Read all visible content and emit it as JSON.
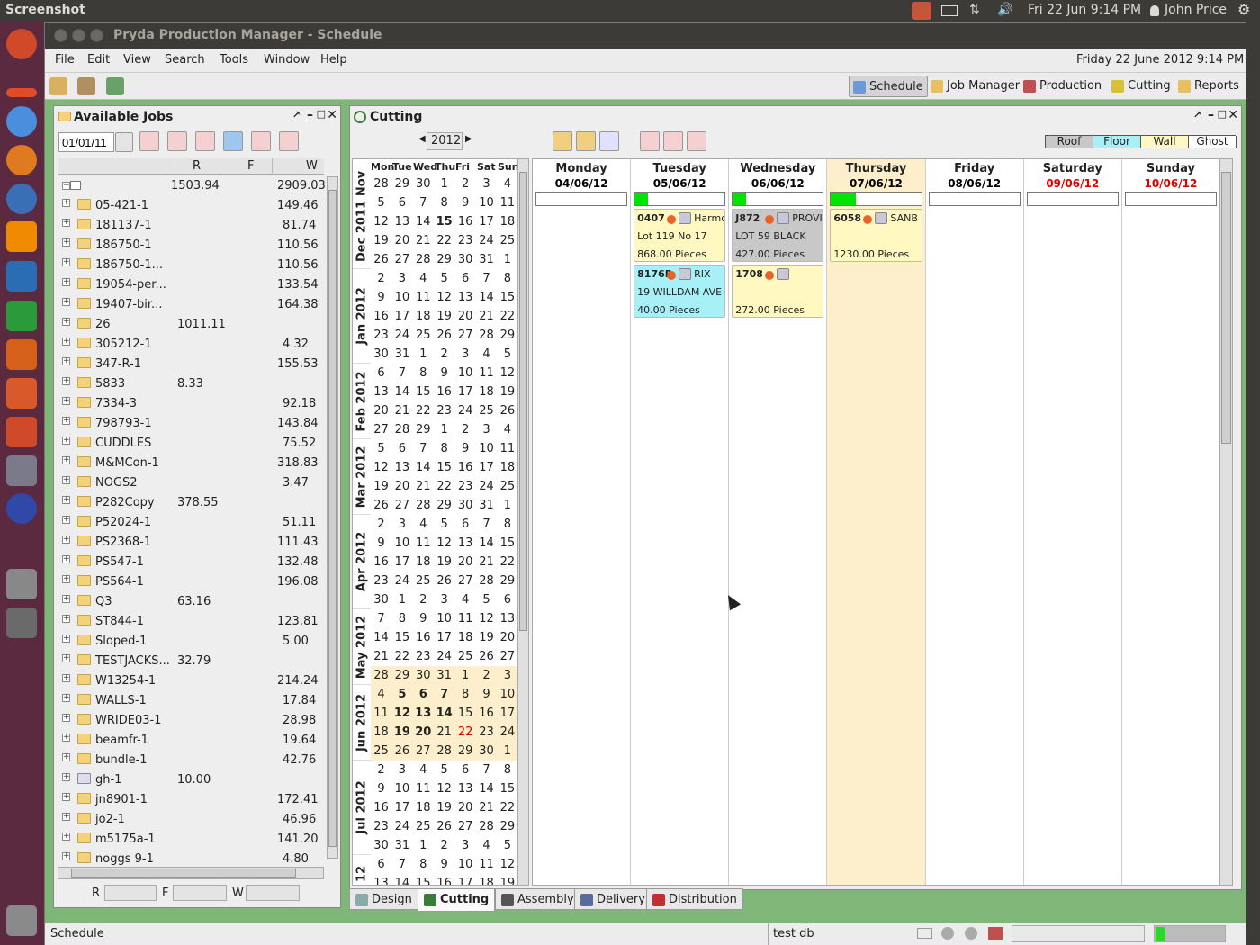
{
  "topbar": {
    "app": "Screenshot",
    "clock": "Fri 22 Jun 9:14 PM",
    "user": "John Price"
  },
  "window": {
    "title": "Pryda Production Manager - Schedule"
  },
  "menu": [
    "File",
    "Edit",
    "View",
    "Search",
    "Tools",
    "Window",
    "Help"
  ],
  "datetime": "Friday 22 June 2012  9:14 PM",
  "nav": [
    {
      "label": "Schedule",
      "active": true
    },
    {
      "label": "Job Manager",
      "active": false
    },
    {
      "label": "Production",
      "active": false
    },
    {
      "label": "Cutting",
      "active": false
    },
    {
      "label": "Reports",
      "active": false
    }
  ],
  "jobs_panel": {
    "title": "Available Jobs",
    "date": "01/01/11",
    "columns": [
      "R",
      "F",
      "W"
    ],
    "root": {
      "r": "1503.94",
      "w": "2909.03"
    },
    "rows": [
      {
        "name": "05-421-1",
        "r": "",
        "w": "149.46"
      },
      {
        "name": "181137-1",
        "r": "",
        "w": "81.74"
      },
      {
        "name": "186750-1",
        "r": "",
        "w": "110.56"
      },
      {
        "name": "186750-1...",
        "r": "",
        "w": "110.56"
      },
      {
        "name": "19054-per...",
        "r": "",
        "w": "133.54"
      },
      {
        "name": "19407-bir...",
        "r": "",
        "w": "164.38"
      },
      {
        "name": "26",
        "r": "1011.11",
        "w": ""
      },
      {
        "name": "305212-1",
        "r": "",
        "w": "4.32"
      },
      {
        "name": "347-R-1",
        "r": "",
        "w": "155.53"
      },
      {
        "name": "5833",
        "r": "8.33",
        "w": ""
      },
      {
        "name": "7334-3",
        "r": "",
        "w": "92.18"
      },
      {
        "name": "798793-1",
        "r": "",
        "w": "143.84"
      },
      {
        "name": "CUDDLES",
        "r": "",
        "w": "75.52"
      },
      {
        "name": "M&MCon-1",
        "r": "",
        "w": "318.83"
      },
      {
        "name": "NOGS2",
        "r": "",
        "w": "3.47"
      },
      {
        "name": "P282Copy",
        "r": "378.55",
        "w": ""
      },
      {
        "name": "P52024-1",
        "r": "",
        "w": "51.11"
      },
      {
        "name": "PS2368-1",
        "r": "",
        "w": "111.43"
      },
      {
        "name": "PS547-1",
        "r": "",
        "w": "132.48"
      },
      {
        "name": "PS564-1",
        "r": "",
        "w": "196.08"
      },
      {
        "name": "Q3",
        "r": "63.16",
        "w": ""
      },
      {
        "name": "ST844-1",
        "r": "",
        "w": "123.81"
      },
      {
        "name": "Sloped-1",
        "r": "",
        "w": "5.00"
      },
      {
        "name": "TESTJACKS...",
        "r": "32.79",
        "w": ""
      },
      {
        "name": "W13254-1",
        "r": "",
        "w": "214.24"
      },
      {
        "name": "WALLS-1",
        "r": "",
        "w": "17.84"
      },
      {
        "name": "WRIDE03-1",
        "r": "",
        "w": "28.98"
      },
      {
        "name": "beamfr-1",
        "r": "",
        "w": "19.64"
      },
      {
        "name": "bundle-1",
        "r": "",
        "w": "42.76"
      },
      {
        "name": "gh-1",
        "r": "10.00",
        "w": ""
      },
      {
        "name": "jn8901-1",
        "r": "",
        "w": "172.41"
      },
      {
        "name": "jo2-1",
        "r": "",
        "w": "46.96"
      },
      {
        "name": "m5175a-1",
        "r": "",
        "w": "141.20"
      },
      {
        "name": "noggs 9-1",
        "r": "",
        "w": "4.80"
      }
    ],
    "footer": [
      "R",
      "F",
      "W"
    ]
  },
  "cutting_panel": {
    "title": "Cutting",
    "year": "2012",
    "legend": [
      {
        "label": "Roof",
        "color": "#c8c8c8"
      },
      {
        "label": "Floor",
        "color": "#a8f0f8"
      },
      {
        "label": "Wall",
        "color": "#fff8c0"
      },
      {
        "label": "Ghost",
        "color": "#ffffff"
      }
    ],
    "cal_header": [
      "Mon",
      "Tue",
      "Wed",
      "Thu",
      "Fri",
      "Sat",
      "Sun"
    ],
    "months": [
      {
        "label": "Nov",
        "rows": 1
      },
      {
        "label": "Dec 2011",
        "rows": 4
      },
      {
        "label": "Jan 2012",
        "rows": 5
      },
      {
        "label": "Feb 2012",
        "rows": 4
      },
      {
        "label": "Mar 2012",
        "rows": 4
      },
      {
        "label": "Apr 2012",
        "rows": 5
      },
      {
        "label": "May 2012",
        "rows": 4
      },
      {
        "label": "Jun 2012",
        "rows": 4
      },
      {
        "label": "Jul 2012",
        "rows": 5
      },
      {
        "label": "12",
        "rows": 2
      }
    ],
    "weeks": [
      [
        "28",
        "29",
        "30",
        "1",
        "2",
        "3",
        "4"
      ],
      [
        "5",
        "6",
        "7",
        "8",
        "9",
        "10",
        "11"
      ],
      [
        "12",
        "13",
        "14",
        "15",
        "16",
        "17",
        "18"
      ],
      [
        "19",
        "20",
        "21",
        "22",
        "23",
        "24",
        "25"
      ],
      [
        "26",
        "27",
        "28",
        "29",
        "30",
        "31",
        "1"
      ],
      [
        "2",
        "3",
        "4",
        "5",
        "6",
        "7",
        "8"
      ],
      [
        "9",
        "10",
        "11",
        "12",
        "13",
        "14",
        "15"
      ],
      [
        "16",
        "17",
        "18",
        "19",
        "20",
        "21",
        "22"
      ],
      [
        "23",
        "24",
        "25",
        "26",
        "27",
        "28",
        "29"
      ],
      [
        "30",
        "31",
        "1",
        "2",
        "3",
        "4",
        "5"
      ],
      [
        "6",
        "7",
        "8",
        "9",
        "10",
        "11",
        "12"
      ],
      [
        "13",
        "14",
        "15",
        "16",
        "17",
        "18",
        "19"
      ],
      [
        "20",
        "21",
        "22",
        "23",
        "24",
        "25",
        "26"
      ],
      [
        "27",
        "28",
        "29",
        "1",
        "2",
        "3",
        "4"
      ],
      [
        "5",
        "6",
        "7",
        "8",
        "9",
        "10",
        "11"
      ],
      [
        "12",
        "13",
        "14",
        "15",
        "16",
        "17",
        "18"
      ],
      [
        "19",
        "20",
        "21",
        "22",
        "23",
        "24",
        "25"
      ],
      [
        "26",
        "27",
        "28",
        "29",
        "30",
        "31",
        "1"
      ],
      [
        "2",
        "3",
        "4",
        "5",
        "6",
        "7",
        "8"
      ],
      [
        "9",
        "10",
        "11",
        "12",
        "13",
        "14",
        "15"
      ],
      [
        "16",
        "17",
        "18",
        "19",
        "20",
        "21",
        "22"
      ],
      [
        "23",
        "24",
        "25",
        "26",
        "27",
        "28",
        "29"
      ],
      [
        "30",
        "1",
        "2",
        "3",
        "4",
        "5",
        "6"
      ],
      [
        "7",
        "8",
        "9",
        "10",
        "11",
        "12",
        "13"
      ],
      [
        "14",
        "15",
        "16",
        "17",
        "18",
        "19",
        "20"
      ],
      [
        "21",
        "22",
        "23",
        "24",
        "25",
        "26",
        "27"
      ],
      [
        "28",
        "29",
        "30",
        "31",
        "1",
        "2",
        "3"
      ],
      [
        "4",
        "5",
        "6",
        "7",
        "8",
        "9",
        "10"
      ],
      [
        "11",
        "12",
        "13",
        "14",
        "15",
        "16",
        "17"
      ],
      [
        "18",
        "19",
        "20",
        "21",
        "22",
        "23",
        "24"
      ],
      [
        "25",
        "26",
        "27",
        "28",
        "29",
        "30",
        "1"
      ],
      [
        "2",
        "3",
        "4",
        "5",
        "6",
        "7",
        "8"
      ],
      [
        "9",
        "10",
        "11",
        "12",
        "13",
        "14",
        "15"
      ],
      [
        "16",
        "17",
        "18",
        "19",
        "20",
        "21",
        "22"
      ],
      [
        "23",
        "24",
        "25",
        "26",
        "27",
        "28",
        "29"
      ],
      [
        "30",
        "31",
        "1",
        "2",
        "3",
        "4",
        "5"
      ],
      [
        "6",
        "7",
        "8",
        "9",
        "10",
        "11",
        "12"
      ],
      [
        "13",
        "14",
        "15",
        "16",
        "17",
        "18",
        "19"
      ]
    ],
    "days": [
      {
        "name": "Monday",
        "date": "04/06/12",
        "date_color": "#000",
        "progress": 0,
        "bg": "#ffffff"
      },
      {
        "name": "Tuesday",
        "date": "05/06/12",
        "date_color": "#000",
        "progress": 0.15,
        "bg": "#ffffff"
      },
      {
        "name": "Wednesday",
        "date": "06/06/12",
        "date_color": "#000",
        "progress": 0.15,
        "bg": "#ffffff"
      },
      {
        "name": "Thursday",
        "date": "07/06/12",
        "date_color": "#000",
        "progress": 0.28,
        "bg": "#fdefcc"
      },
      {
        "name": "Friday",
        "date": "08/06/12",
        "date_color": "#000",
        "progress": 0,
        "bg": "#ffffff"
      },
      {
        "name": "Saturday",
        "date": "09/06/12",
        "date_color": "#e00000",
        "progress": 0,
        "bg": "#ffffff"
      },
      {
        "name": "Sunday",
        "date": "10/06/12",
        "date_color": "#e00000",
        "progress": 0,
        "bg": "#ffffff"
      }
    ],
    "jobs": [
      {
        "day": 1,
        "slot": 0,
        "code": "0407",
        "client": "Harmo",
        "line2": "Lot 119 No 17",
        "qty": "868.00 Pieces",
        "color": "#fff8c0"
      },
      {
        "day": 1,
        "slot": 1,
        "code": "8176R",
        "client": "RIX",
        "line2": "19 WILLDAM AVE",
        "qty": "40.00 Pieces",
        "color": "#a8f0f8"
      },
      {
        "day": 2,
        "slot": 0,
        "code": "J872",
        "client": "PROVINC",
        "line2": "LOT 59 BLACK",
        "qty": "427.00 Pieces",
        "color": "#c8c8c8"
      },
      {
        "day": 2,
        "slot": 1,
        "code": "1708",
        "client": "",
        "line2": "",
        "qty": "272.00 Pieces",
        "color": "#fff8c0"
      },
      {
        "day": 3,
        "slot": 0,
        "code": "6058",
        "client": "SANB",
        "line2": "",
        "qty": "1230.00 Pieces",
        "color": "#fff8c0"
      }
    ]
  },
  "bottom_tabs": [
    {
      "label": "Design",
      "active": false
    },
    {
      "label": "Cutting",
      "active": true
    },
    {
      "label": "Assembly",
      "active": false
    },
    {
      "label": "Delivery",
      "active": false
    },
    {
      "label": "Distribution",
      "active": false
    }
  ],
  "status": {
    "left": "Schedule",
    "db": "test db"
  }
}
